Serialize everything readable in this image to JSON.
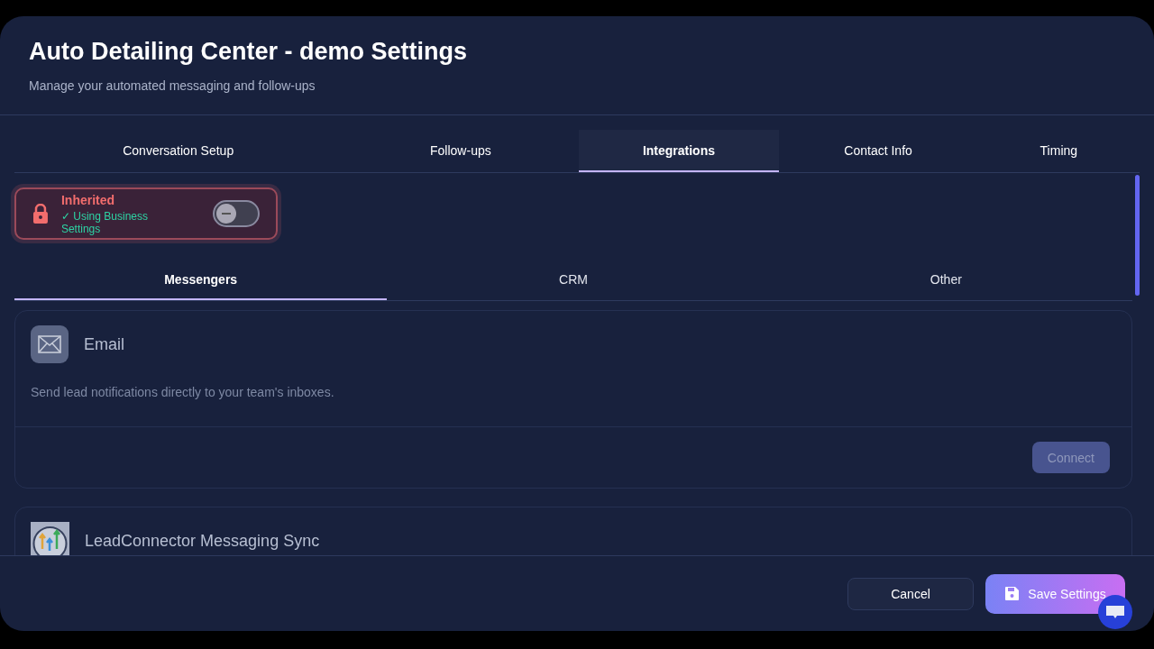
{
  "dialog": {
    "title": "Auto Detailing Center - demo Settings",
    "subtitle": "Manage your automated messaging and follow-ups"
  },
  "tabs": [
    {
      "label": "Conversation Setup",
      "selected": false
    },
    {
      "label": "Follow-ups",
      "selected": false
    },
    {
      "label": "Integrations",
      "selected": true
    },
    {
      "label": "Contact Info",
      "selected": false
    },
    {
      "label": "Timing",
      "selected": false
    }
  ],
  "inheritance": {
    "label": "Inherited",
    "status": "✓ Using Business Settings",
    "on": false
  },
  "subtabs": [
    {
      "label": "Messengers",
      "selected": true
    },
    {
      "label": "CRM",
      "selected": false
    },
    {
      "label": "Other",
      "selected": false
    }
  ],
  "integrations": [
    {
      "kind": "email",
      "name": "Email",
      "description": "Send lead notifications directly to your team's inboxes.",
      "action": {
        "label": "Connect",
        "disabled": true
      }
    },
    {
      "kind": "logo",
      "name": "LeadConnector Messaging Sync"
    }
  ],
  "footer": {
    "cancel": "Cancel",
    "save": "Save Settings"
  }
}
